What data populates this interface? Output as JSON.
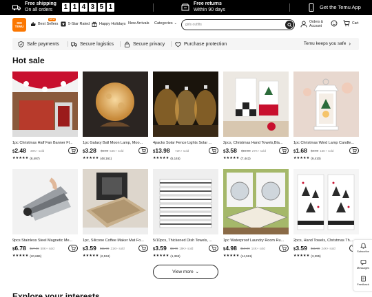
{
  "topbar": {
    "free_shipping_title": "Free shipping",
    "free_shipping_sub": "On all orders",
    "countdown_digits": [
      "1",
      "1",
      "4",
      "3",
      "5",
      "1"
    ],
    "free_returns_title": "Free returns",
    "free_returns_sub": "Within 90 days",
    "get_app": "Get the Temu App"
  },
  "header": {
    "logo_text_top": "⊞⊞",
    "logo_text_bottom": "TEMU",
    "nav": {
      "best_sellers": "Best Sellers",
      "best_sellers_badge": "NEW",
      "five_star": "5-Star Rated",
      "happy_holidays": "Happy Holidays",
      "new_arrivals": "New Arrivals",
      "categories": "Categories"
    },
    "search": {
      "value": "girls outfits",
      "placeholder": ""
    },
    "orders_line1": "Orders &",
    "orders_line2": "Account",
    "cart": "Cart"
  },
  "benefits": {
    "items": [
      "Safe payments",
      "Secure logistics",
      "Secure privacy",
      "Purchase protection"
    ],
    "right_text": "Temu keeps you safe"
  },
  "hot_sale": {
    "title": "Hot sale",
    "products": [
      {
        "title": "1pc Christmas Half Fan Banner Fl...",
        "price": "2.48",
        "old": "",
        "sold": "39K+ sold",
        "reviews": "(8,497)",
        "stars": "★★★★★"
      },
      {
        "title": "1pc Galaxy Ball Moon Lamp, Moo...",
        "price": "3.28",
        "old": "$6.99",
        "sold": "54K+ sold",
        "reviews": "(48,161)",
        "stars": "★★★★★"
      },
      {
        "title": "4packs Solar Fence Lights Solar ...",
        "price": "13.98",
        "old": "",
        "sold": "72K+ sold",
        "reviews": "(5,145)",
        "stars": "★★★★★"
      },
      {
        "title": "2pcs, Christmas Hand Towels,Bla...",
        "price": "3.58",
        "old": "$15.99",
        "sold": "27K+ sold",
        "reviews": "(7,442)",
        "stars": "★★★★★"
      },
      {
        "title": "1pc Christmas Wind Lamp Candle...",
        "price": "1.68",
        "old": "$4.99",
        "sold": "15K+ sold",
        "reviews": "(9,410)",
        "stars": "★★★★★"
      },
      {
        "title": "9pcs Stainless Steel Magnetic Me...",
        "price": "6.78",
        "old": "$17.98",
        "sold": "58K+ sold",
        "reviews": "(20,686)",
        "stars": "★★★★★"
      },
      {
        "title": "1pc, Silicone Coffee Maker Mat Fo...",
        "price": "3.59",
        "old": "$11.99",
        "sold": "21K+ sold",
        "reviews": "(2,534)",
        "stars": "★★★★★"
      },
      {
        "title": "5/10pcs, Thickened Dish Towels, ...",
        "price": "3.59",
        "old": "$8.70",
        "sold": "19K+ sold",
        "reviews": "(1,369)",
        "stars": "★★★★★"
      },
      {
        "title": "1pc Waterproof Laundry Room Ru...",
        "price": "4.98",
        "old": "$10.99",
        "sold": "14K+ sold",
        "reviews": "(14,591)",
        "stars": "★★★★★"
      },
      {
        "title": "2pcs, Hand Towels, Christmas Th...",
        "price": "3.59",
        "old": "$11.99",
        "sold": "24K+ sold",
        "reviews": "(3,395)",
        "stars": "★★★★★"
      }
    ],
    "currency": "$",
    "view_more": "View more"
  },
  "explore_title": "Explore your interests",
  "side_panel": {
    "subscribe": "Subscribe",
    "messages": "Messages",
    "feedback": "Feedback"
  }
}
